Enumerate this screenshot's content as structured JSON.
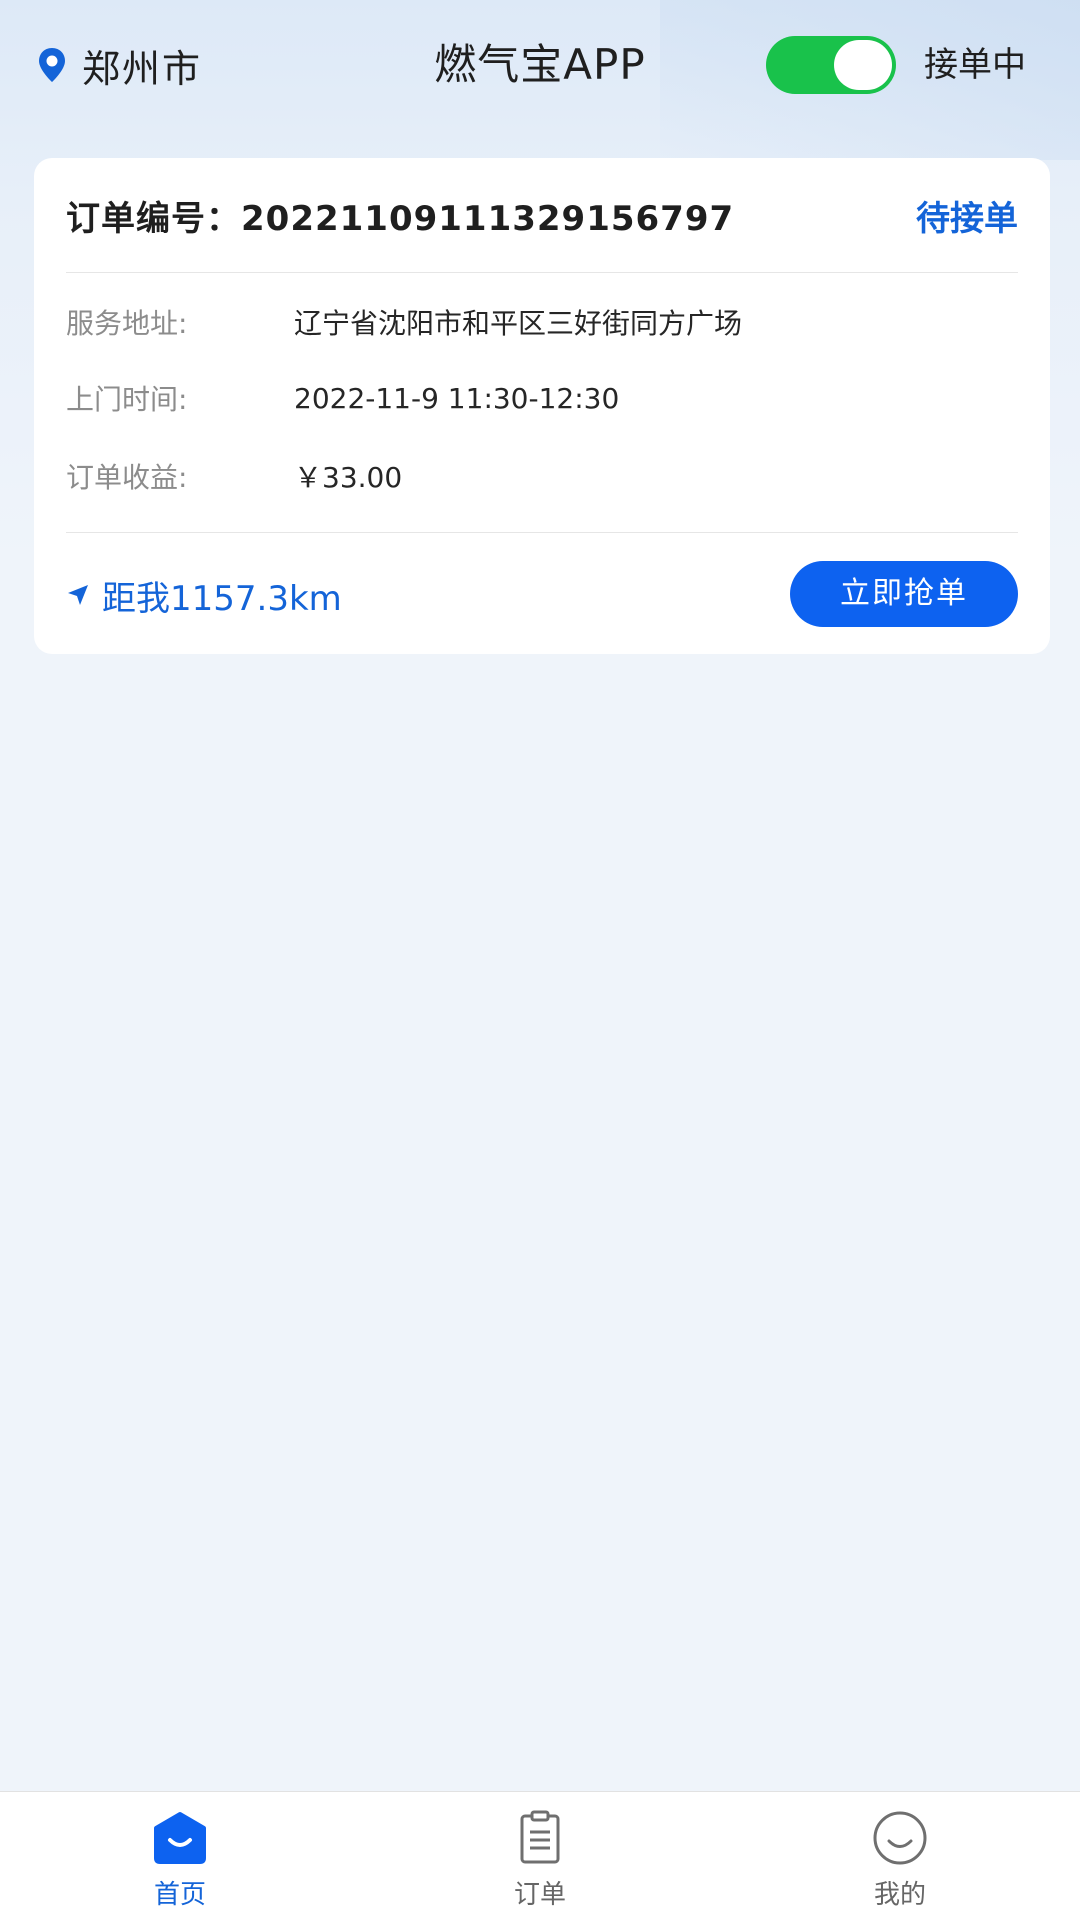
{
  "header": {
    "city": "郑州市",
    "title": "燃气宝APP",
    "toggle_on": true,
    "toggle_label": "接单中"
  },
  "order": {
    "order_no": "订单编号：20221109111329156797",
    "status": "待接单",
    "address_label": "服务地址:",
    "address": "辽宁省沈阳市和平区三好街同方广场",
    "time_label": "上门时间:",
    "time": "2022-11-9 11:30-12:30",
    "income_label": "订单收益:",
    "income": "￥33.00",
    "distance": "距我1157.3km",
    "grab_button": "立即抢单"
  },
  "tabbar": {
    "items": [
      {
        "label": "首页",
        "icon": "home-icon",
        "active": true
      },
      {
        "label": "订单",
        "icon": "clipboard-icon",
        "active": false
      },
      {
        "label": "我的",
        "icon": "smile-icon",
        "active": false
      }
    ]
  },
  "colors": {
    "accent": "#1464d8",
    "button": "#0d62f0",
    "toggle": "#19c24b"
  }
}
